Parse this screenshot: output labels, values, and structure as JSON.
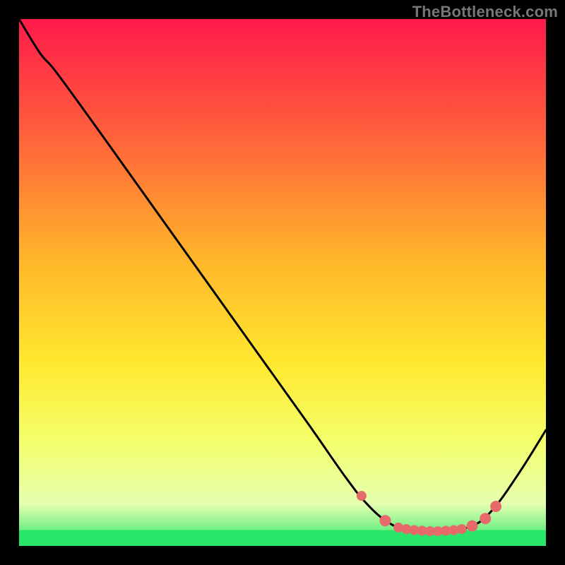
{
  "attribution": "TheBottleneck.com",
  "chart_data": {
    "type": "line",
    "title": "",
    "xlabel": "",
    "ylabel": "",
    "xlim": [
      0,
      100
    ],
    "ylim": [
      0,
      100
    ],
    "grid": false,
    "legend": false,
    "gradient_stops": [
      {
        "offset": 0,
        "color": "#ff1a4b"
      },
      {
        "offset": 20,
        "color": "#ff5a3c"
      },
      {
        "offset": 45,
        "color": "#ffb42a"
      },
      {
        "offset": 65,
        "color": "#ffe82e"
      },
      {
        "offset": 80,
        "color": "#f4ff6a"
      },
      {
        "offset": 92,
        "color": "#e6ffb0"
      },
      {
        "offset": 100,
        "color": "#29e66b"
      }
    ],
    "green_band": {
      "y0": 97.0,
      "y1": 100.0
    },
    "series": [
      {
        "name": "bottleneck-curve",
        "color": "#000000",
        "points": [
          {
            "x": 0.0,
            "y": 0.0
          },
          {
            "x": 4.0,
            "y": 6.5
          },
          {
            "x": 7.0,
            "y": 10.0
          },
          {
            "x": 15.0,
            "y": 21.0
          },
          {
            "x": 25.0,
            "y": 35.0
          },
          {
            "x": 35.0,
            "y": 49.0
          },
          {
            "x": 45.0,
            "y": 63.0
          },
          {
            "x": 55.0,
            "y": 77.0
          },
          {
            "x": 62.0,
            "y": 87.0
          },
          {
            "x": 66.0,
            "y": 92.0
          },
          {
            "x": 70.0,
            "y": 95.5
          },
          {
            "x": 74.0,
            "y": 97.0
          },
          {
            "x": 80.0,
            "y": 97.3
          },
          {
            "x": 86.0,
            "y": 96.2
          },
          {
            "x": 90.0,
            "y": 93.0
          },
          {
            "x": 95.0,
            "y": 86.0
          },
          {
            "x": 100.0,
            "y": 78.0
          }
        ]
      }
    ],
    "markers": {
      "name": "highlighted-points",
      "color": "#e76a6a",
      "radius_small": 7,
      "radius_large": 8,
      "points": [
        {
          "x": 65.0,
          "y": 90.5,
          "r": "small"
        },
        {
          "x": 69.5,
          "y": 95.2,
          "r": "large"
        },
        {
          "x": 72.0,
          "y": 96.5,
          "r": "small"
        },
        {
          "x": 73.5,
          "y": 96.8,
          "r": "small"
        },
        {
          "x": 75.0,
          "y": 97.0,
          "r": "small"
        },
        {
          "x": 76.5,
          "y": 97.1,
          "r": "small"
        },
        {
          "x": 78.0,
          "y": 97.2,
          "r": "small"
        },
        {
          "x": 79.5,
          "y": 97.2,
          "r": "small"
        },
        {
          "x": 81.0,
          "y": 97.1,
          "r": "small"
        },
        {
          "x": 82.5,
          "y": 97.0,
          "r": "small"
        },
        {
          "x": 84.0,
          "y": 96.8,
          "r": "small"
        },
        {
          "x": 86.0,
          "y": 96.2,
          "r": "large"
        },
        {
          "x": 88.5,
          "y": 94.8,
          "r": "large"
        },
        {
          "x": 90.5,
          "y": 92.5,
          "r": "large"
        }
      ]
    }
  }
}
